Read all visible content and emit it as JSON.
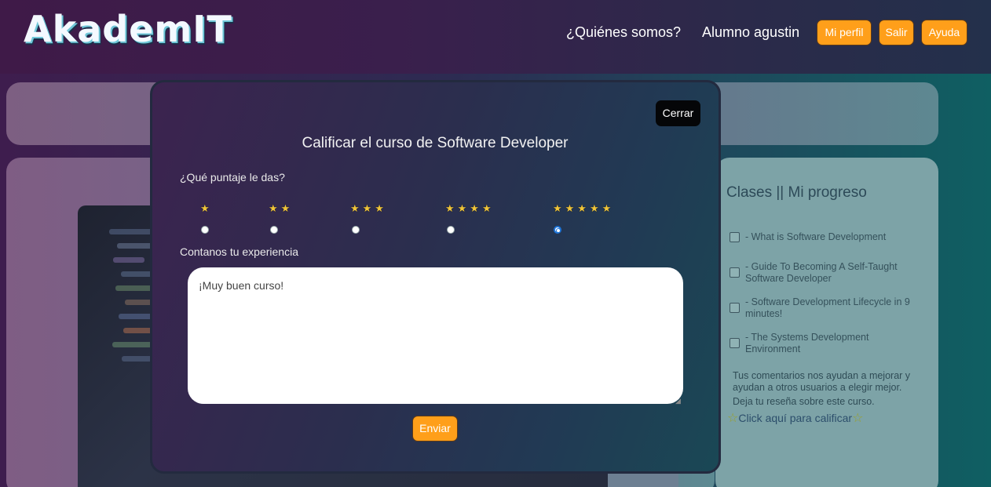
{
  "header": {
    "logo": "AkademIT",
    "nav_about": "¿Quiénes somos?",
    "nav_user": "Alumno agustin",
    "btn_profile": "Mi perfil",
    "btn_logout": "Salir",
    "btn_help": "Ayuda"
  },
  "sidebar": {
    "title": "Clases || Mi progreso",
    "lessons": [
      {
        "label": "- What is Software Development",
        "checked": false
      },
      {
        "label": "- Guide To Becoming A Self-Taught Software Developer",
        "checked": false
      },
      {
        "label": "- Software Development Lifecycle in 9 minutes!",
        "checked": false
      },
      {
        "label": "- The Systems Development Environment",
        "checked": false
      }
    ],
    "note_1": "Tus comentarios nos ayudan a mejorar y ayudan a otros usuarios a elegir mejor.",
    "note_2": "Deja tu reseña sobre este curso.",
    "rate_link": "Click aquí para calificar"
  },
  "modal": {
    "close_label": "Cerrar",
    "title": "Calificar el curso de Software Developer",
    "score_question": "¿Qué puntaje le das?",
    "rating_options": [
      {
        "stars": "★",
        "value": 1
      },
      {
        "stars": "★★",
        "value": 2
      },
      {
        "stars": "★★★",
        "value": 3
      },
      {
        "stars": "★★★★",
        "value": 4
      },
      {
        "stars": "★★★★★",
        "value": 5
      }
    ],
    "selected_rating": 5,
    "experience_label": "Contanos tu experiencia",
    "experience_text": "¡Muy buen curso!",
    "send_label": "Enviar"
  },
  "colors": {
    "accent": "#ff9f1a",
    "star": "#f0c53a",
    "radio_selected": "#1d74d8"
  }
}
